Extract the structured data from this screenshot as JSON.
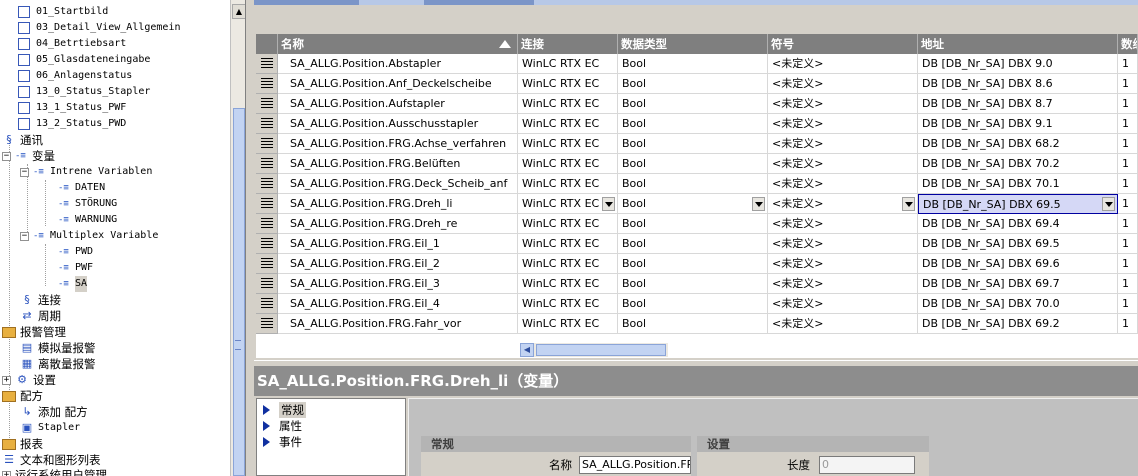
{
  "tree": {
    "items": [
      {
        "label": "01_Startbild"
      },
      {
        "label": "03_Detail_View_Allgemein"
      },
      {
        "label": "04_Betrtiebsart"
      },
      {
        "label": "05_Glasdateneingabe"
      },
      {
        "label": "06_Anlagenstatus"
      },
      {
        "label": "13_0_Status_Stapler"
      },
      {
        "label": "13_1_Status_PWF"
      },
      {
        "label": "13_2_Status_PWD"
      },
      {
        "label": "通讯"
      },
      {
        "label": "变量"
      },
      {
        "label": "Intrene Variablen"
      },
      {
        "label": "DATEN"
      },
      {
        "label": "STÖRUNG"
      },
      {
        "label": "WARNUNG"
      },
      {
        "label": "Multiplex Variable"
      },
      {
        "label": "PWD"
      },
      {
        "label": "PWF"
      },
      {
        "label": "SA"
      },
      {
        "label": "连接"
      },
      {
        "label": "周期"
      },
      {
        "label": "报警管理"
      },
      {
        "label": "模拟量报警"
      },
      {
        "label": "离散量报警"
      },
      {
        "label": "设置"
      },
      {
        "label": "配方"
      },
      {
        "label": "添加 配方"
      },
      {
        "label": "Stapler"
      },
      {
        "label": "报表"
      },
      {
        "label": "文本和图形列表"
      },
      {
        "label": "运行系统用户管理"
      }
    ]
  },
  "grid": {
    "columns": [
      "名称",
      "连接",
      "数据类型",
      "符号",
      "地址",
      "数组"
    ],
    "rows": [
      {
        "name": "SA_ALLG.Position.Abstapler",
        "conn": "WinLC RTX EC",
        "type": "Bool",
        "symbol": "<未定义>",
        "addr": "DB [DB_Nr_SA] DBX 9.0",
        "count": "1"
      },
      {
        "name": "SA_ALLG.Position.Anf_Deckelscheibe",
        "conn": "WinLC RTX EC",
        "type": "Bool",
        "symbol": "<未定义>",
        "addr": "DB [DB_Nr_SA] DBX 8.6",
        "count": "1"
      },
      {
        "name": "SA_ALLG.Position.Aufstapler",
        "conn": "WinLC RTX EC",
        "type": "Bool",
        "symbol": "<未定义>",
        "addr": "DB [DB_Nr_SA] DBX 8.7",
        "count": "1"
      },
      {
        "name": "SA_ALLG.Position.Ausschusstapler",
        "conn": "WinLC RTX EC",
        "type": "Bool",
        "symbol": "<未定义>",
        "addr": "DB [DB_Nr_SA] DBX 9.1",
        "count": "1"
      },
      {
        "name": "SA_ALLG.Position.FRG.Achse_verfahren",
        "conn": "WinLC RTX EC",
        "type": "Bool",
        "symbol": "<未定义>",
        "addr": "DB [DB_Nr_SA] DBX 68.2",
        "count": "1"
      },
      {
        "name": "SA_ALLG.Position.FRG.Belüften",
        "conn": "WinLC RTX EC",
        "type": "Bool",
        "symbol": "<未定义>",
        "addr": "DB [DB_Nr_SA] DBX 70.2",
        "count": "1"
      },
      {
        "name": "SA_ALLG.Position.FRG.Deck_Scheib_anf",
        "conn": "WinLC RTX EC",
        "type": "Bool",
        "symbol": "<未定义>",
        "addr": "DB [DB_Nr_SA] DBX 70.1",
        "count": "1"
      },
      {
        "name": "SA_ALLG.Position.FRG.Dreh_li",
        "conn": "WinLC RTX EC",
        "type": "Bool",
        "symbol": "<未定义>",
        "addr": "DB [DB_Nr_SA] DBX 69.5",
        "count": "1"
      },
      {
        "name": "SA_ALLG.Position.FRG.Dreh_re",
        "conn": "WinLC RTX EC",
        "type": "Bool",
        "symbol": "<未定义>",
        "addr": "DB [DB_Nr_SA] DBX 69.4",
        "count": "1"
      },
      {
        "name": "SA_ALLG.Position.FRG.Eil_1",
        "conn": "WinLC RTX EC",
        "type": "Bool",
        "symbol": "<未定义>",
        "addr": "DB [DB_Nr_SA] DBX 69.5",
        "count": "1"
      },
      {
        "name": "SA_ALLG.Position.FRG.Eil_2",
        "conn": "WinLC RTX EC",
        "type": "Bool",
        "symbol": "<未定义>",
        "addr": "DB [DB_Nr_SA] DBX 69.6",
        "count": "1"
      },
      {
        "name": "SA_ALLG.Position.FRG.Eil_3",
        "conn": "WinLC RTX EC",
        "type": "Bool",
        "symbol": "<未定义>",
        "addr": "DB [DB_Nr_SA] DBX 69.7",
        "count": "1"
      },
      {
        "name": "SA_ALLG.Position.FRG.Eil_4",
        "conn": "WinLC RTX EC",
        "type": "Bool",
        "symbol": "<未定义>",
        "addr": "DB [DB_Nr_SA] DBX 70.0",
        "count": "1"
      },
      {
        "name": "SA_ALLG.Position.FRG.Fahr_vor",
        "conn": "WinLC RTX EC",
        "type": "Bool",
        "symbol": "<未定义>",
        "addr": "DB [DB_Nr_SA] DBX 69.2",
        "count": "1"
      }
    ]
  },
  "props": {
    "title": "SA_ALLG.Position.FRG.Dreh_li（变量）",
    "nav": [
      "常规",
      "属性",
      "事件"
    ],
    "group_general": "常规",
    "group_settings": "设置",
    "name_label": "名称",
    "name_value": "SA_ALLG.Position.FR",
    "length_label": "长度",
    "length_value": "0"
  },
  "colors": {
    "header_bg": "#7f7f7f",
    "selection_bg": "#d5d8f6",
    "accent": "#1030a0"
  }
}
